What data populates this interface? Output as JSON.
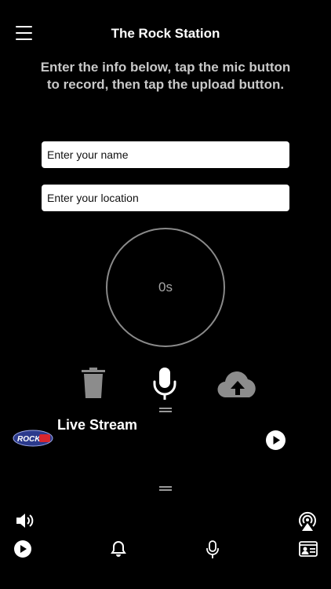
{
  "header": {
    "title": "The Rock Station",
    "menu_icon": "hamburger-menu-icon"
  },
  "instructions": "Enter the info below, tap the mic button to record, then tap the upload button.",
  "form": {
    "name_placeholder": "Enter your name",
    "location_placeholder": "Enter your location"
  },
  "recorder": {
    "timer": "0s",
    "buttons": [
      "trash-icon",
      "microphone-icon",
      "cloud-upload-icon"
    ]
  },
  "live_stream": {
    "label": "Live Stream",
    "logo_text": "ROCK",
    "play_icon": "play-circle-icon"
  },
  "bottom_bar": {
    "top_row": [
      "speaker-icon",
      "airplay-icon"
    ],
    "tabs": [
      "play-circle-icon",
      "bell-icon",
      "microphone-icon",
      "contact-card-icon"
    ]
  },
  "colors": {
    "background": "#000000",
    "text": "#ffffff",
    "muted_text": "#c8c8c8",
    "disabled_icon": "#8c8c8c",
    "logo_blue": "#2b3a8c",
    "logo_red": "#d8262e"
  }
}
